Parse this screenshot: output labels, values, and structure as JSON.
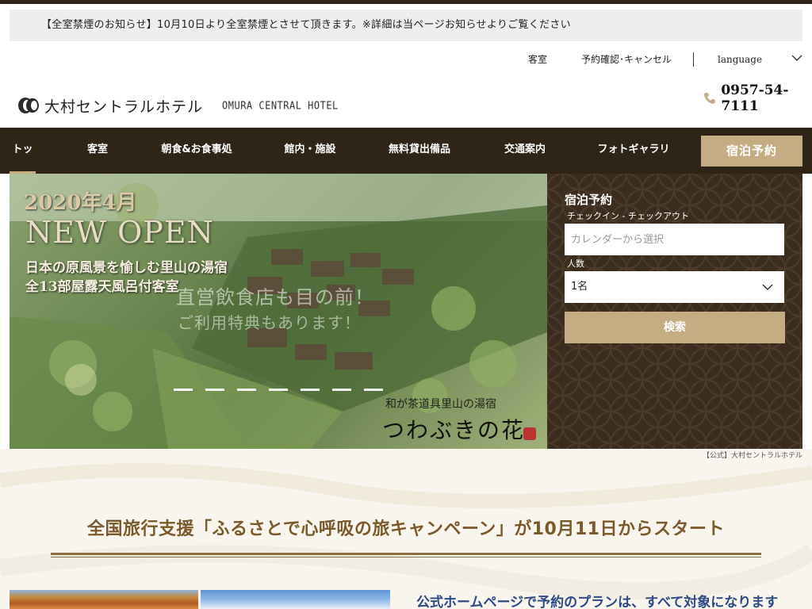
{
  "notice": {
    "text": "【全室禁煙のお知らせ】10月10日より全室禁煙とさせて頂きます。※詳細は当ページお知らせよりご覧ください"
  },
  "utility": {
    "rooms": "客室",
    "reservation": "予約確認･キャンセル",
    "language": "language"
  },
  "logo": {
    "name_jp": "大村セントラルホテル",
    "name_en": "OMURA CENTRAL HOTEL"
  },
  "phone": {
    "number": "0957-54-7111"
  },
  "nav": {
    "items": [
      "トップ",
      "客室",
      "朝食&お食事処",
      "館内・施設",
      "無料貸出備品",
      "交通案内",
      "フォトギャラリー"
    ],
    "book": "宿泊予約"
  },
  "hero": {
    "year": "2020年4月",
    "headline": "NEW OPEN",
    "line1": "日本の原風景を愉しむ里山の湯宿",
    "line2": "全13部屋露天風呂付客室",
    "promo1": "直営飲食店も目の前！",
    "promo2": "ご利用特典もあります！",
    "brush": "和が茶道具里山の湯宿",
    "brand": "つわぶきの花",
    "slide_count": 7,
    "active_slide": 0
  },
  "booking": {
    "title": "宿泊予約",
    "dates_label": "チェックイン - チェックアウト",
    "dates_placeholder": "カレンダーから選択",
    "guests_label": "人数",
    "guests_value": "1名",
    "search": "検索"
  },
  "caption": "【公式】大村セントラルホテル",
  "campaign": {
    "title": "全国旅行支援「ふるさとで心呼吸の旅キャンペーン」が10月11日からスタート",
    "plan_text": "公式ホームページで予約のプランは、すべて対象になります"
  },
  "colors": {
    "brown": "#2e2418",
    "gold": "#c4ac85",
    "campaign_text": "#7a5a2b",
    "plan_text": "#2d4a86"
  },
  "icons": {
    "logo": "oc-logo-mark",
    "phone": "phone-icon",
    "chevron": "chevron-down-icon"
  }
}
